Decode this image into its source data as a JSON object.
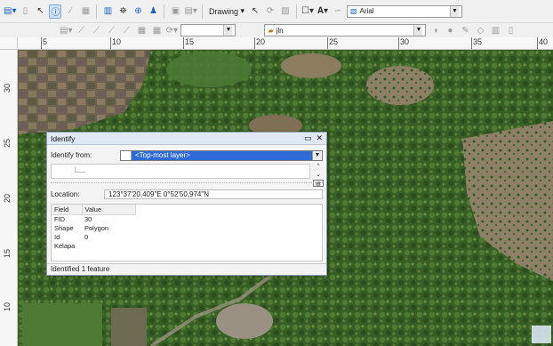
{
  "toolbar": {
    "drawing_label": "Drawing",
    "font_name": "Arial",
    "layer_name": "jln"
  },
  "ruler": {
    "top_ticks": [
      "5",
      "10",
      "15",
      "20",
      "25",
      "30",
      "35",
      "40"
    ],
    "left_ticks": [
      "30",
      "25",
      "20",
      "15",
      "10"
    ]
  },
  "identify": {
    "title": "Identify",
    "from_label": "Identify from:",
    "from_value": "<Top-most layer>",
    "location_label": "Location:",
    "location_value": "123°37'20,409\"E  0°52'50,974\"N",
    "columns": [
      "Field",
      "Value"
    ],
    "rows": [
      {
        "field": "FID",
        "value": "30"
      },
      {
        "field": "Shape",
        "value": "Polygon"
      },
      {
        "field": "Id",
        "value": "0"
      },
      {
        "field": "Kelapa",
        "value": ""
      }
    ],
    "status": "Identified 1 feature"
  },
  "colors": {
    "map_green": "#2f5a22",
    "map_field": "#8c7d62",
    "titlebar": "#dfe8f3",
    "selection": "#2f6bd6"
  }
}
